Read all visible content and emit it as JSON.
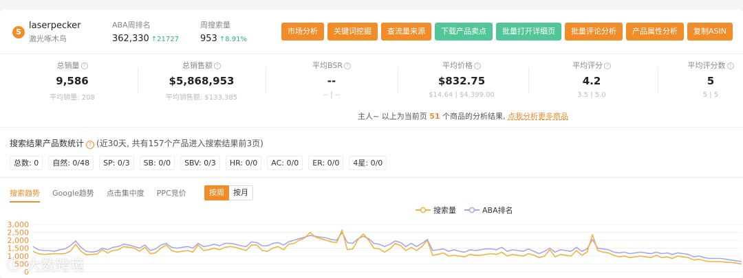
{
  "header": {
    "brand_name": "laserpecker",
    "brand_sub": "激光啄木鸟",
    "aba_label": "ABA周排名",
    "aba_value": "362,330",
    "aba_change": "↑21727",
    "weekly_search_label": "周搜索量",
    "weekly_search_value": "953",
    "weekly_search_change": "↑8.91%"
  },
  "buttons": [
    {
      "label": "市场分析",
      "style": "orange"
    },
    {
      "label": "关键词挖掘",
      "style": "orange"
    },
    {
      "label": "查流量来源",
      "style": "orange"
    },
    {
      "label": "下载产品卖点",
      "style": "green"
    },
    {
      "label": "批量打开详细页",
      "style": "green"
    },
    {
      "label": "批量评论分析",
      "style": "orange"
    },
    {
      "label": "产品属性分析",
      "style": "orange"
    },
    {
      "label": "复制ASIN",
      "style": "orange"
    }
  ],
  "metrics": [
    {
      "label": "总销量",
      "value": "9,586",
      "sub": "平均销量: 208"
    },
    {
      "label": "总销售额",
      "value": "$5,868,953",
      "sub": "平均销售额: $133,385"
    },
    {
      "label": "平均BSR",
      "value": "--",
      "sub": "-- | --"
    },
    {
      "label": "平均价格",
      "value": "$832.75",
      "sub": "$14.64 | $4,399.00"
    },
    {
      "label": "平均评分",
      "value": "4.2",
      "sub": "3.5 | 5.0"
    },
    {
      "label": "平均评分数",
      "value": "5",
      "sub": "5 | 5"
    }
  ],
  "notice": {
    "prefix": "主人~ 以上为当前页",
    "count": "51",
    "suffix": "个商品的分析结果,",
    "link": "点我分析更多商品"
  },
  "search_results": {
    "title": "搜索结果产品数统计",
    "note": "(近30天, 共有157个产品进入搜索结果前3页)",
    "chips": [
      "总数: 0",
      "自然: 0/48",
      "SP: 0/3",
      "SB: 0/0",
      "SBV: 0/3",
      "HR: 0/0",
      "AC: 0/0",
      "ER: 0/0",
      "4星: 0/0"
    ]
  },
  "trend": {
    "tabs": [
      "搜索趋势",
      "Google趋势",
      "点击集中度",
      "PPC竞价"
    ],
    "active_tab": 0,
    "period_week": "按周",
    "period_month": "按月",
    "legend_search": "搜索量",
    "legend_aba": "ABA排名",
    "colors": {
      "search": "#f0b43c",
      "aba": "#a9a6e8"
    }
  },
  "watermark": "大数跨境",
  "chart_data": {
    "type": "line",
    "y_ticks": [
      "3,000",
      "2,500",
      "2,000",
      "1,500",
      "1,000",
      "500",
      "0"
    ],
    "ylim": [
      0,
      3000
    ],
    "series": [
      {
        "name": "搜索量",
        "values": [
          1300,
          1150,
          1100,
          1120,
          1150,
          1140,
          1160,
          1300,
          1750,
          1300,
          1080,
          1100,
          1120,
          1400,
          1200,
          1350,
          1400,
          1600,
          1550,
          1500,
          1300,
          1550,
          1150,
          1200,
          1500,
          1700,
          1350,
          1250,
          1300,
          1350,
          1250,
          1700,
          1350,
          1400,
          1500,
          1400,
          1550,
          1600,
          1550,
          1450,
          1350,
          1700,
          1700,
          1350,
          1300,
          1500,
          1600,
          1400,
          1750,
          1800,
          2000,
          2150,
          2500,
          2200,
          2100,
          2000,
          1900,
          1850,
          2650,
          1400,
          1450,
          2050,
          2400,
          2000,
          1500,
          1450,
          1250,
          1450,
          1800,
          1650,
          1350,
          1550,
          1350,
          1600,
          2000,
          1050,
          1100,
          1200,
          1000,
          1050,
          1000,
          950,
          1100,
          1050,
          1050,
          1100,
          1150,
          1100,
          1250,
          1000,
          1100,
          1050,
          1000,
          1150,
          1050,
          900,
          1000,
          1400,
          950,
          1100,
          1050,
          1000,
          1350,
          1050,
          1250,
          2350,
          1350,
          1250,
          1200,
          1050,
          950,
          1000,
          900,
          950,
          1000,
          950,
          900,
          1050,
          900,
          950,
          850,
          1000,
          950,
          900,
          750,
          800,
          700,
          650,
          650,
          650,
          600,
          600,
          550,
          500
        ]
      },
      {
        "name": "ABA排名",
        "values": [
          1600,
          1400,
          1350,
          1350,
          1300,
          1400,
          1450,
          1650,
          1950,
          1550,
          1300,
          1250,
          1300,
          1500,
          1400,
          1550,
          1600,
          1750,
          1700,
          1600,
          1500,
          1700,
          1350,
          1450,
          1700,
          1800,
          1550,
          1500,
          1550,
          1600,
          1500,
          1800,
          1600,
          1650,
          1750,
          1650,
          1800,
          1800,
          1750,
          1650,
          1600,
          1900,
          1850,
          1650,
          1650,
          1800,
          1850,
          1700,
          1900,
          2000,
          2100,
          2200,
          2300,
          2250,
          2200,
          2150,
          2050,
          2000,
          2500,
          1850,
          1800,
          2100,
          2250,
          2100,
          1800,
          1750,
          1600,
          1750,
          1950,
          1850,
          1600,
          1800,
          1600,
          1800,
          2050,
          1350,
          1400,
          1450,
          1300,
          1400,
          1300,
          1250,
          1400,
          1350,
          1400,
          1450,
          1450,
          1400,
          1550,
          1300,
          1400,
          1350,
          1300,
          1450,
          1300,
          1150,
          1300,
          1500,
          1250,
          1400,
          1350,
          1300,
          1550,
          1300,
          1450,
          2050,
          1500,
          1450,
          1400,
          1250,
          1200,
          1250,
          1150,
          1200,
          1250,
          1200,
          1150,
          1250,
          1150,
          1200,
          1100,
          1200,
          1150,
          1100,
          950,
          1000,
          900,
          850,
          850,
          850,
          800,
          750,
          700,
          650
        ]
      }
    ]
  }
}
